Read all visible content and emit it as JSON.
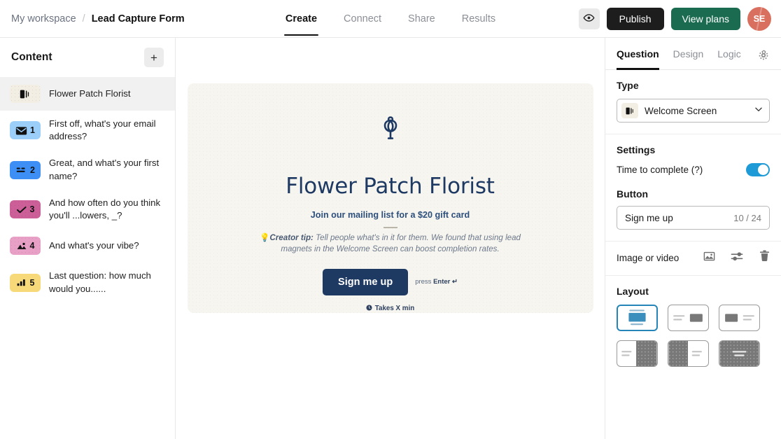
{
  "header": {
    "workspace": "My workspace",
    "separator": "/",
    "form_title": "Lead Capture Form",
    "tabs": [
      {
        "label": "Create",
        "active": true
      },
      {
        "label": "Connect",
        "active": false
      },
      {
        "label": "Share",
        "active": false
      },
      {
        "label": "Results",
        "active": false
      }
    ],
    "preview_icon": "eye-icon",
    "publish_label": "Publish",
    "view_plans_label": "View plans",
    "avatar_initials": "SE",
    "accent_publish": "#1d1d1d",
    "accent_plans": "#1b6b51",
    "avatar_color": "#d9705f"
  },
  "sidebar": {
    "title": "Content",
    "add_label": "+",
    "items": [
      {
        "num": "",
        "label": "Flower Patch Florist",
        "icon": "welcome-screen-icon",
        "badge_color": "#f3eee3",
        "selected": true
      },
      {
        "num": "1",
        "label": "First off, what's your email address?",
        "icon": "email-icon",
        "badge_color": "#9ccefa",
        "selected": false
      },
      {
        "num": "2",
        "label": "Great, and what's your first name?",
        "icon": "short-text-icon",
        "badge_color": "#3d8ff5",
        "selected": false
      },
      {
        "num": "3",
        "label": "And how often do you think you'll ...lowers, _?",
        "icon": "multiple-choice-icon",
        "badge_color": "#cc5f97",
        "selected": false
      },
      {
        "num": "4",
        "label": "And what's your vibe?",
        "icon": "picture-choice-icon",
        "badge_color": "#e8a0c6",
        "selected": false
      },
      {
        "num": "5",
        "label": "Last question: how much would you......",
        "icon": "opinion-scale-icon",
        "badge_color": "#f7d97a",
        "selected": false
      }
    ]
  },
  "canvas": {
    "logo_icon": "tulip-logo-icon",
    "title": "Flower Patch Florist",
    "subtitle": "Join our mailing list for a $20 gift card",
    "tip_bulb": "💡",
    "tip_lead": "Creator tip:",
    "tip_body": " Tell people what's in it for them. We found that using lead magnets in the Welcome Screen can boost completion rates.",
    "cta_label": "Sign me up",
    "press_prefix": "press ",
    "press_key": "Enter ↵",
    "takes_text": "Takes X min",
    "card_bg": "#f6f5ef",
    "brand_navy": "#1e3a63"
  },
  "panel": {
    "tabs": [
      {
        "label": "Question",
        "active": true
      },
      {
        "label": "Design",
        "active": false
      },
      {
        "label": "Logic",
        "active": false
      }
    ],
    "settings_icon": "gear-icon",
    "type_label": "Type",
    "type_value": "Welcome Screen",
    "type_icon": "welcome-screen-icon",
    "chevron_icon": "chevron-down-icon",
    "settings_label": "Settings",
    "time_to_complete_label": "Time to complete (?)",
    "time_to_complete_on": true,
    "toggle_color": "#1e9bd7",
    "button_label": "Button",
    "button_value": "Sign me up",
    "button_counter": "10 / 24",
    "media_label": "Image or video",
    "media_icons": [
      "image-icon",
      "sliders-icon",
      "trash-icon"
    ],
    "layout_label": "Layout",
    "layout_options": [
      {
        "name": "layout-stacked-center",
        "selected": true
      },
      {
        "name": "layout-text-left-image-right-small",
        "selected": false
      },
      {
        "name": "layout-image-left-small-text-right",
        "selected": false
      },
      {
        "name": "layout-text-left-image-right-half",
        "selected": false
      },
      {
        "name": "layout-image-left-half-text-right",
        "selected": false
      },
      {
        "name": "layout-full-background",
        "selected": false
      }
    ],
    "selected_layout_color": "#2585b8"
  }
}
